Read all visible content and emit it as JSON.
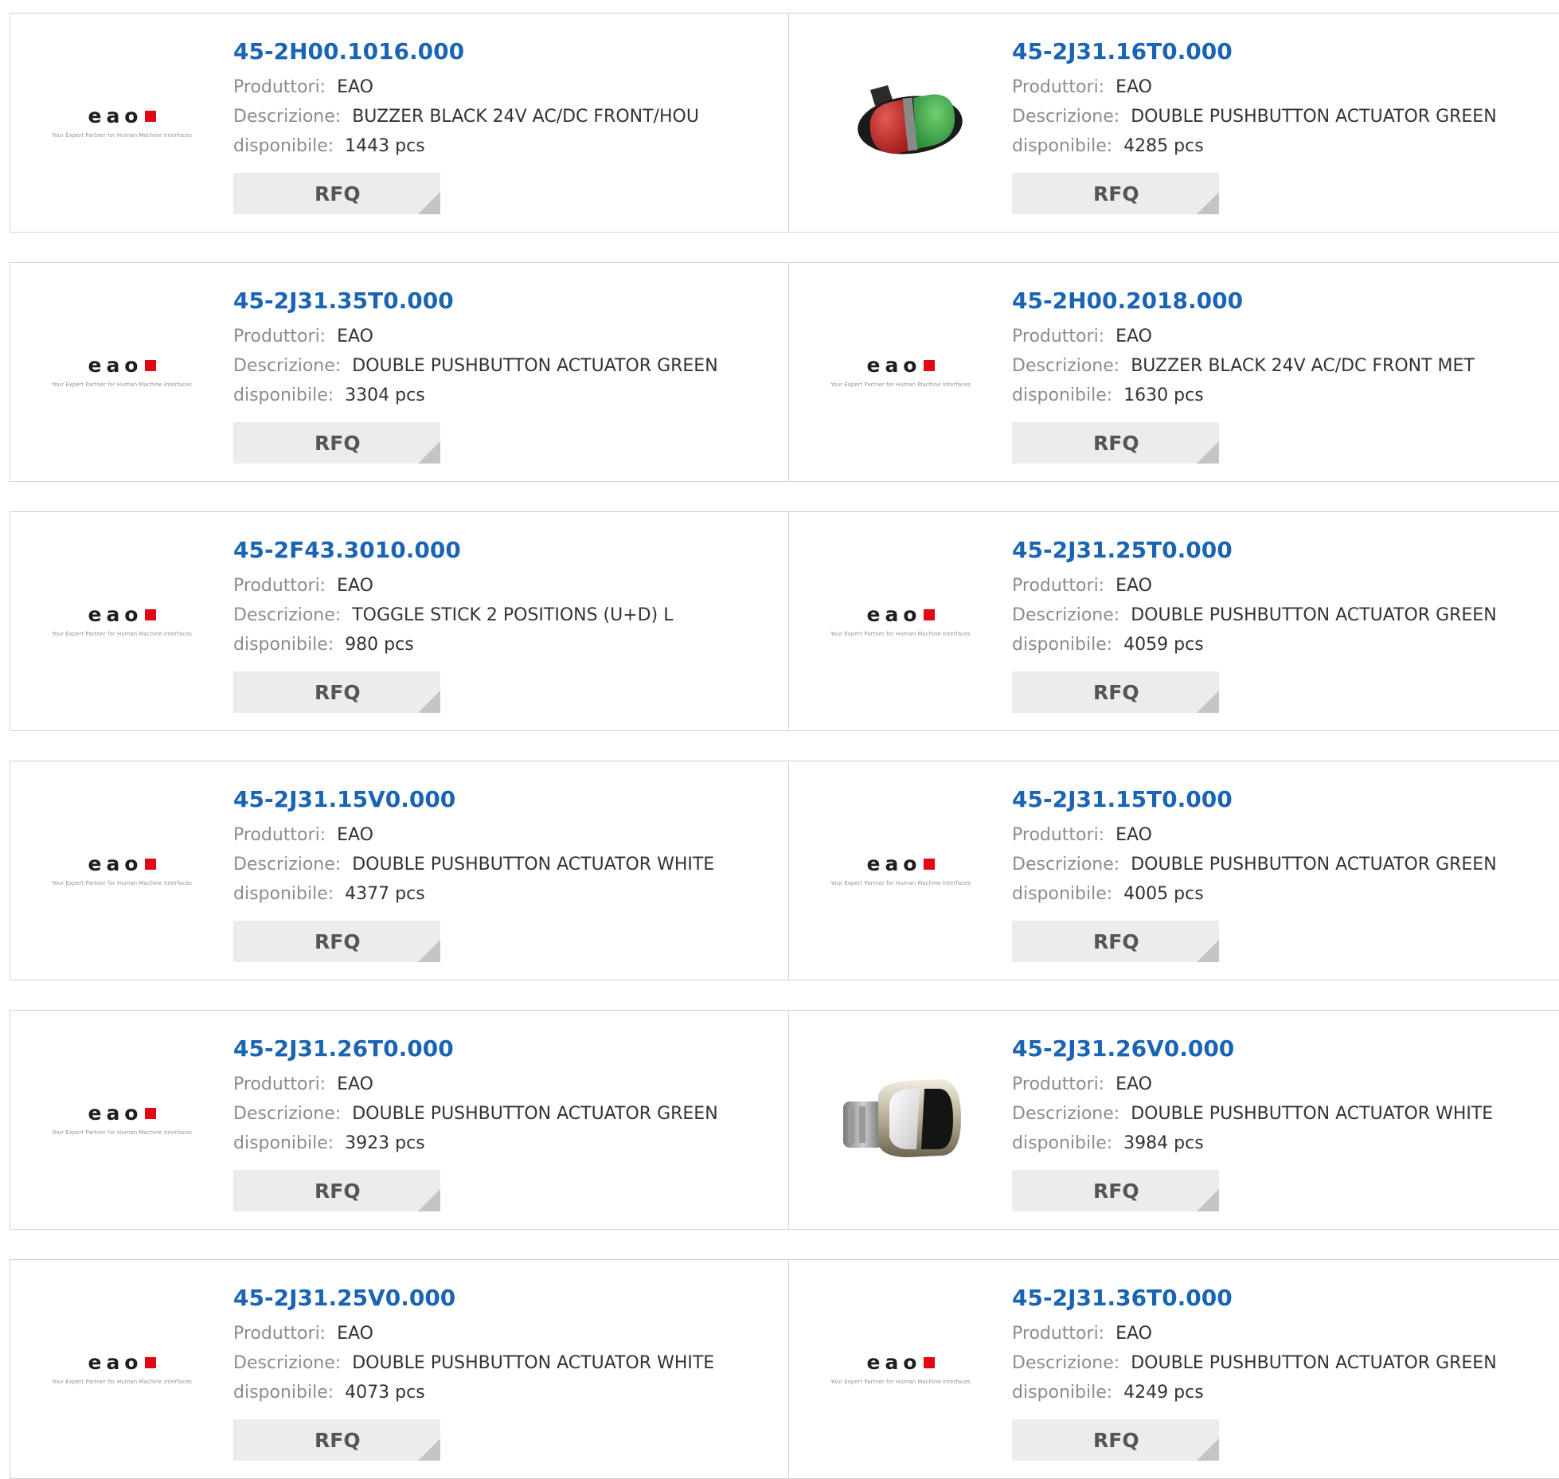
{
  "labels": {
    "manufacturer": "Produttori:",
    "description": "Descrizione:",
    "available": "disponibile:",
    "rfq": "RFQ"
  },
  "brand_logo": {
    "word": "eao",
    "tagline": "Your Expert Partner for Human Machine Interfaces"
  },
  "products": [
    {
      "part": "45-2H00.1016.000",
      "manufacturer": "EAO",
      "description": "BUZZER BLACK 24V AC/DC FRONT/HOU",
      "available": "1443 pcs",
      "image": "eao-logo"
    },
    {
      "part": "45-2J31.16T0.000",
      "manufacturer": "EAO",
      "description": "DOUBLE PUSHBUTTON ACTUATOR GREEN",
      "available": "4285 pcs",
      "image": "red-green-double-pushbutton-photo"
    },
    {
      "part": "45-2J31.35T0.000",
      "manufacturer": "EAO",
      "description": "DOUBLE PUSHBUTTON ACTUATOR GREEN",
      "available": "3304 pcs",
      "image": "eao-logo"
    },
    {
      "part": "45-2H00.2018.000",
      "manufacturer": "EAO",
      "description": "BUZZER BLACK 24V AC/DC FRONT MET",
      "available": "1630 pcs",
      "image": "eao-logo"
    },
    {
      "part": "45-2F43.3010.000",
      "manufacturer": "EAO",
      "description": "TOGGLE STICK 2 POSITIONS (U+D) L",
      "available": "980 pcs",
      "image": "eao-logo"
    },
    {
      "part": "45-2J31.25T0.000",
      "manufacturer": "EAO",
      "description": "DOUBLE PUSHBUTTON ACTUATOR GREEN",
      "available": "4059 pcs",
      "image": "eao-logo"
    },
    {
      "part": "45-2J31.15V0.000",
      "manufacturer": "EAO",
      "description": "DOUBLE PUSHBUTTON ACTUATOR WHITE",
      "available": "4377 pcs",
      "image": "eao-logo"
    },
    {
      "part": "45-2J31.15T0.000",
      "manufacturer": "EAO",
      "description": "DOUBLE PUSHBUTTON ACTUATOR GREEN",
      "available": "4005 pcs",
      "image": "eao-logo"
    },
    {
      "part": "45-2J31.26T0.000",
      "manufacturer": "EAO",
      "description": "DOUBLE PUSHBUTTON ACTUATOR GREEN",
      "available": "3923 pcs",
      "image": "eao-logo"
    },
    {
      "part": "45-2J31.26V0.000",
      "manufacturer": "EAO",
      "description": "DOUBLE PUSHBUTTON ACTUATOR WHITE",
      "available": "3984 pcs",
      "image": "chrome-white-double-pushbutton-photo"
    },
    {
      "part": "45-2J31.25V0.000",
      "manufacturer": "EAO",
      "description": "DOUBLE PUSHBUTTON ACTUATOR WHITE",
      "available": "4073 pcs",
      "image": "eao-logo"
    },
    {
      "part": "45-2J31.36T0.000",
      "manufacturer": "EAO",
      "description": "DOUBLE PUSHBUTTON ACTUATOR GREEN",
      "available": "4249 pcs",
      "image": "eao-logo"
    }
  ],
  "colors": {
    "link": "#1a64b4",
    "label": "#8c8c8c",
    "value": "#333333",
    "button_bg": "#ececec",
    "brand_red": "#e30613"
  }
}
